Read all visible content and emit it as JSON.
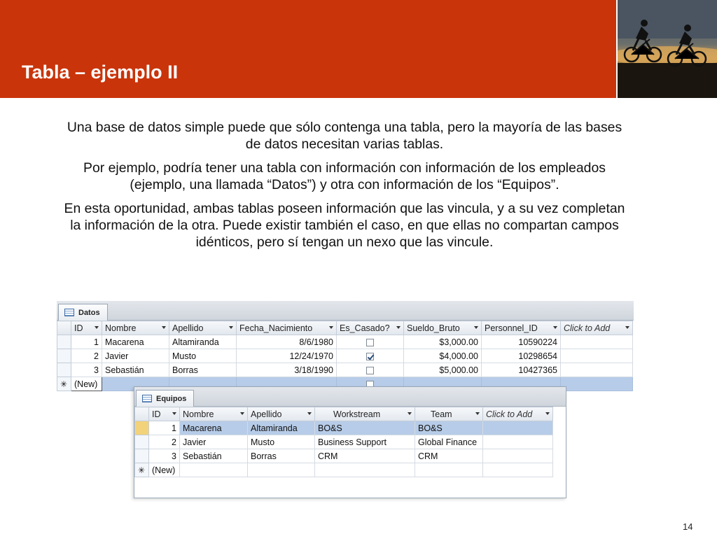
{
  "slide": {
    "title": "Tabla – ejemplo II",
    "page_number": "14",
    "paragraphs": [
      "Una base de datos simple puede que sólo contenga una tabla, pero la mayoría de las bases de datos necesitan varias tablas.",
      "Por ejemplo, podría tener una tabla con información con información de los empleados (ejemplo, una llamada “Datos”) y otra con información de los “Equipos”.",
      "En esta oportunidad, ambas tablas poseen información que las vincula, y a su vez completan la información de la otra. Puede existir también el caso, en que ellas no compartan campos idénticos, pero sí tengan un nexo que las vincule."
    ],
    "accent_color": "#c9340a"
  },
  "datos": {
    "tab_label": "Datos",
    "headers": [
      "ID",
      "Nombre",
      "Apellido",
      "Fecha_Nacimiento",
      "Es_Casado?",
      "Sueldo_Bruto",
      "Personnel_ID",
      "Click to Add"
    ],
    "rows": [
      {
        "id": "1",
        "nombre": "Macarena",
        "apellido": "Altamiranda",
        "fecha": "8/6/1980",
        "casado": false,
        "sueldo": "$3,000.00",
        "personnel": "10590224"
      },
      {
        "id": "2",
        "nombre": "Javier",
        "apellido": "Musto",
        "fecha": "12/24/1970",
        "casado": true,
        "sueldo": "$4,000.00",
        "personnel": "10298654"
      },
      {
        "id": "3",
        "nombre": "Sebastián",
        "apellido": "Borras",
        "fecha": "3/18/1990",
        "casado": false,
        "sueldo": "$5,000.00",
        "personnel": "10427365"
      }
    ],
    "new_row_label": "(New)",
    "new_row_marker": "✳"
  },
  "equipos": {
    "tab_label": "Equipos",
    "headers": [
      "ID",
      "Nombre",
      "Apellido",
      "Workstream",
      "Team",
      "Click to Add"
    ],
    "rows": [
      {
        "id": "1",
        "nombre": "Macarena",
        "apellido": "Altamiranda",
        "workstream": "BO&S",
        "team": "BO&S"
      },
      {
        "id": "2",
        "nombre": "Javier",
        "apellido": "Musto",
        "workstream": "Business Support",
        "team": "Global Finance"
      },
      {
        "id": "3",
        "nombre": "Sebastián",
        "apellido": "Borras",
        "workstream": "CRM",
        "team": "CRM"
      }
    ],
    "new_row_label": "(New)",
    "new_row_marker": "✳"
  },
  "icons": {
    "table_icon": "table-icon",
    "dropdown_icon": "chevron-down-icon",
    "checkbox_icon": "checkbox-icon",
    "photo": "cyclists-photo"
  }
}
